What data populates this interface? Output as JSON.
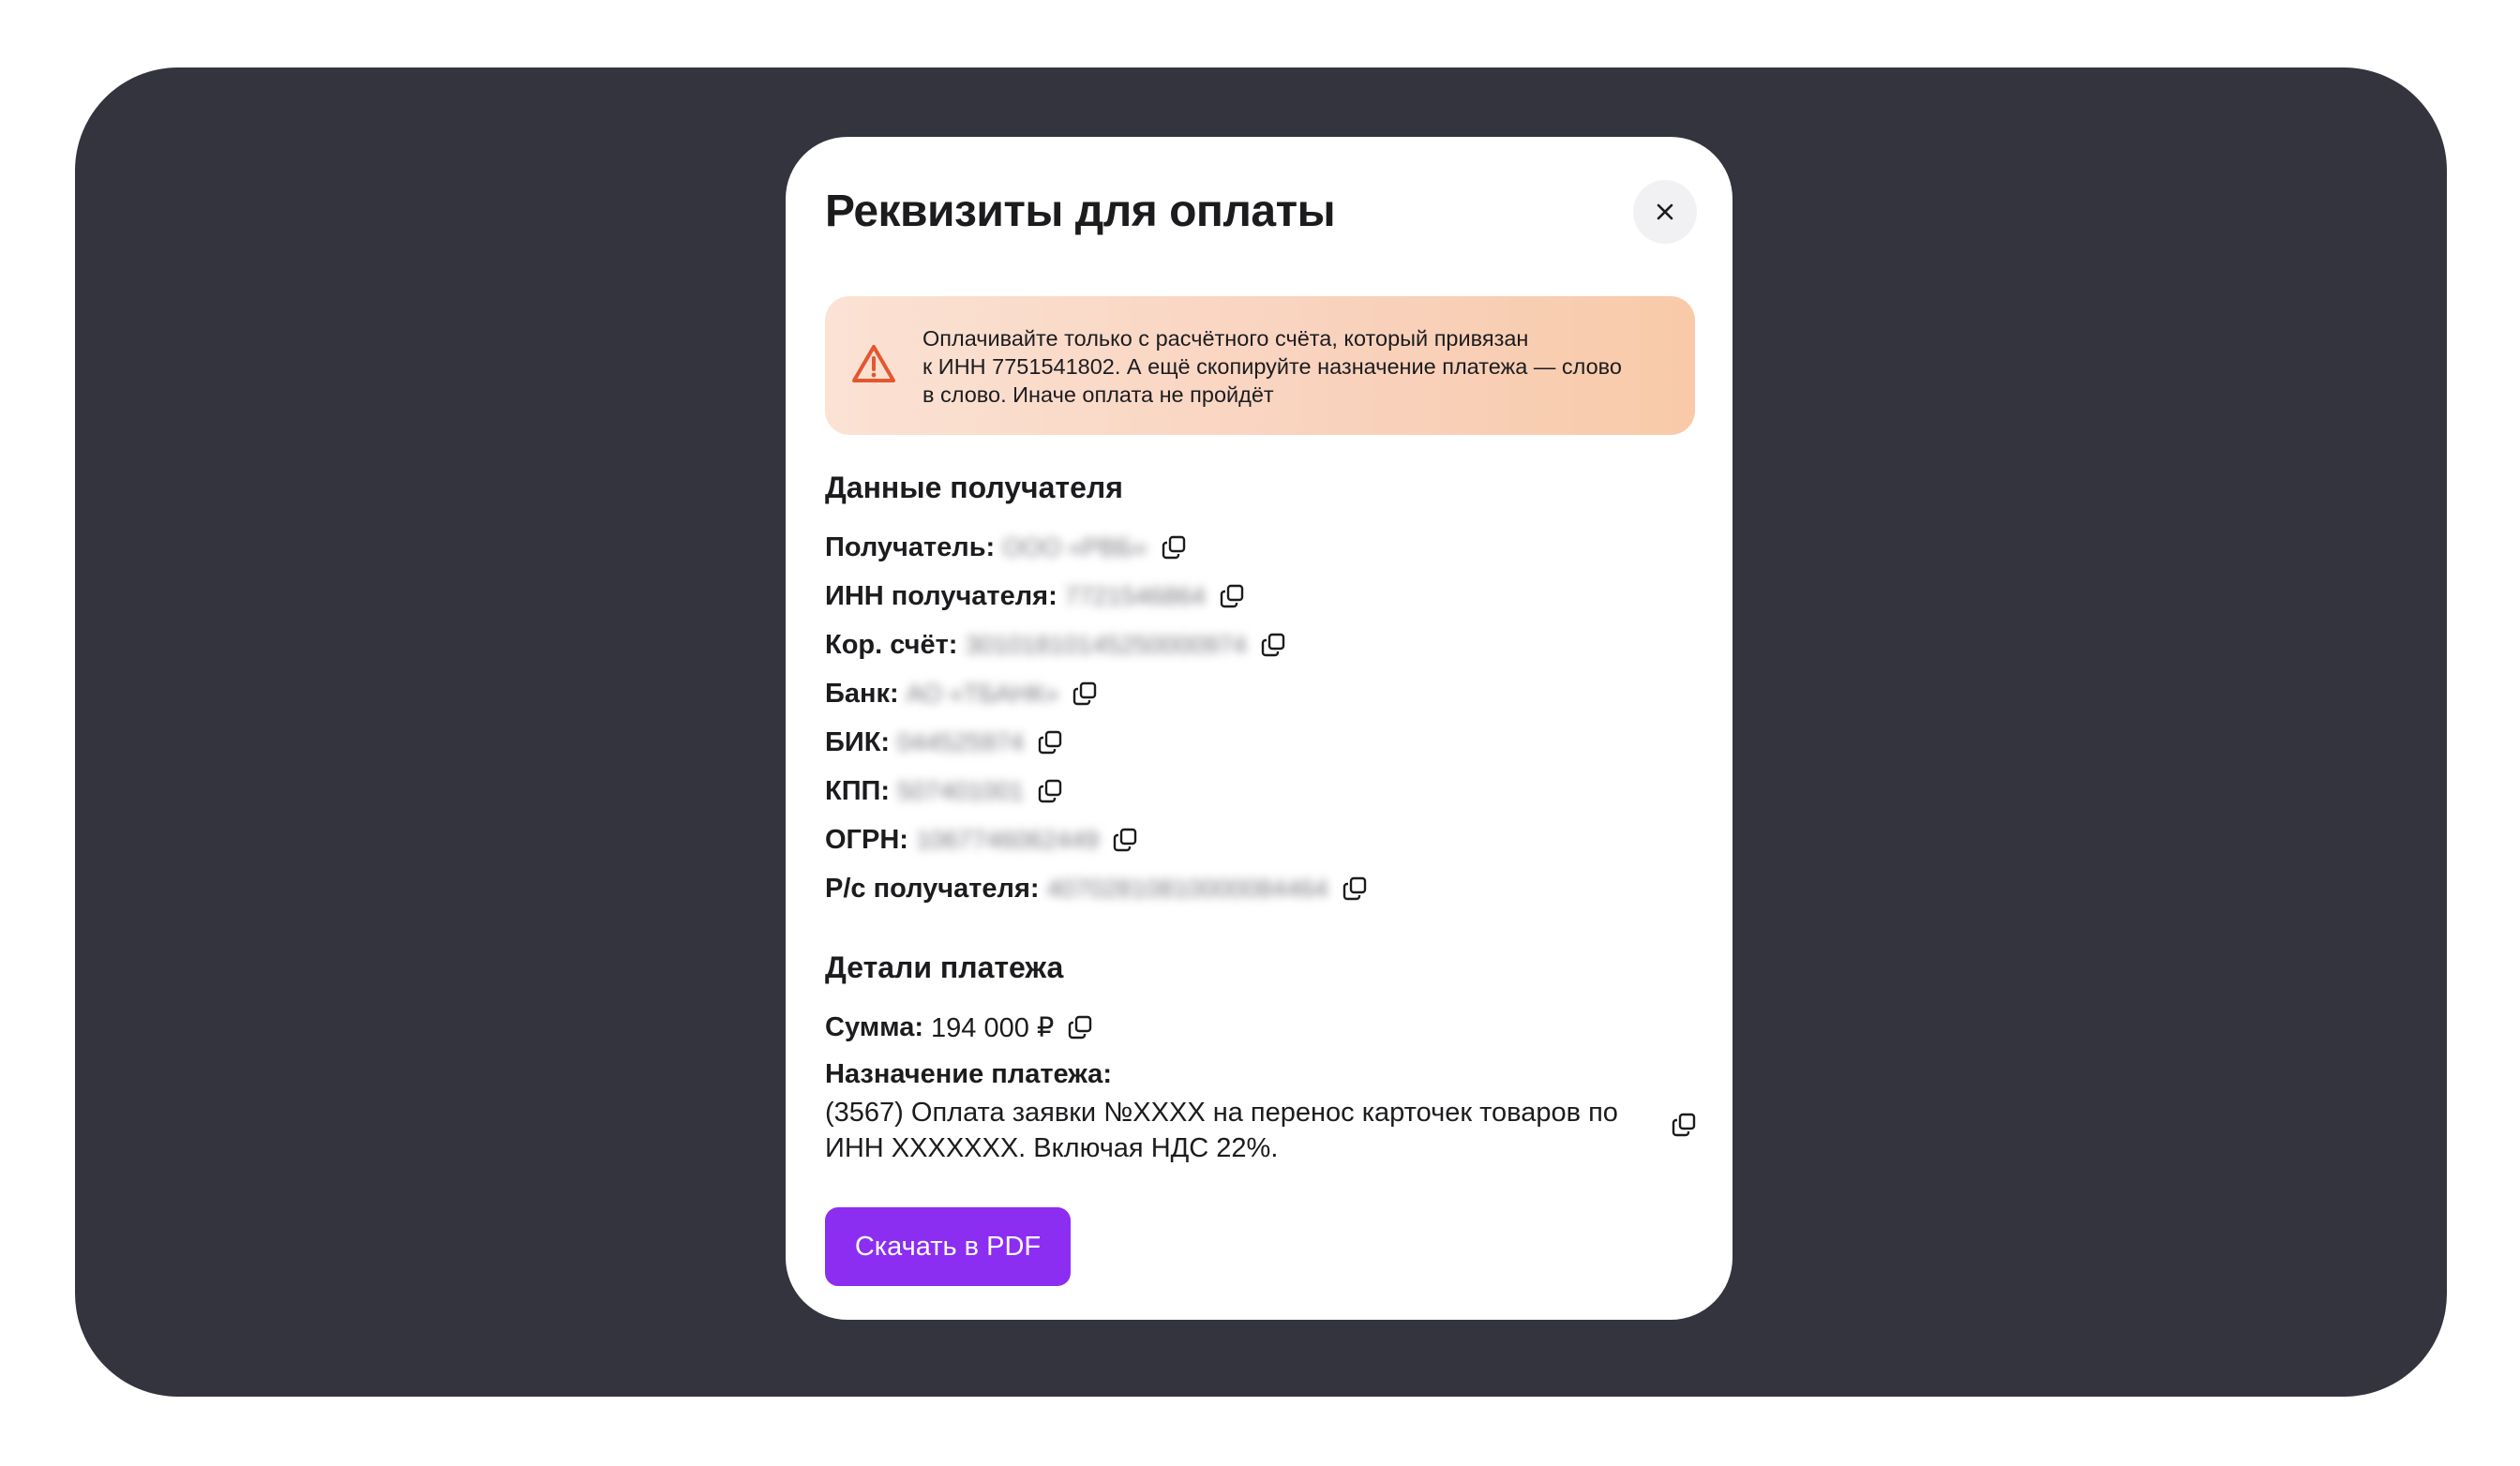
{
  "modal": {
    "title": "Реквизиты для оплаты",
    "close_icon": "close-icon"
  },
  "warning": {
    "icon": "warning-triangle-icon",
    "text": "Оплачивайте только с расчётного счёта, который привязан\nк ИНН 7751541802. А ещё скопируйте назначение платежа — слово\nв слово. Иначе оплата не пройдёт"
  },
  "recipient": {
    "title": "Данные получателя",
    "rows": [
      {
        "label": "Получатель:",
        "value": "ООО «РВБ»"
      },
      {
        "label": "ИНН получателя:",
        "value": "7721546864"
      },
      {
        "label": "Кор. счёт:",
        "value": "30101810145250000974"
      },
      {
        "label": "Банк:",
        "value": "АО «ТБАНК»"
      },
      {
        "label": "БИК:",
        "value": "044525974"
      },
      {
        "label": "КПП:",
        "value": "507401001"
      },
      {
        "label": "ОГРН:",
        "value": "1067746062449"
      },
      {
        "label": "Р/с получателя:",
        "value": "40702810810000084464"
      }
    ]
  },
  "payment": {
    "title": "Детали платежа",
    "amount_label": "Сумма:",
    "amount_value": "194 000 ₽",
    "purpose_label": "Назначение платежа:",
    "purpose_text": "(3567) Оплата заявки №XXXX на перенос карточек товаров по ИНН XXXXXXX. Включая НДС 22%."
  },
  "actions": {
    "download_label": "Скачать в PDF"
  },
  "colors": {
    "backdrop": "#34343f",
    "accent": "#8c2df2",
    "warning_icon": "#e4572e"
  }
}
